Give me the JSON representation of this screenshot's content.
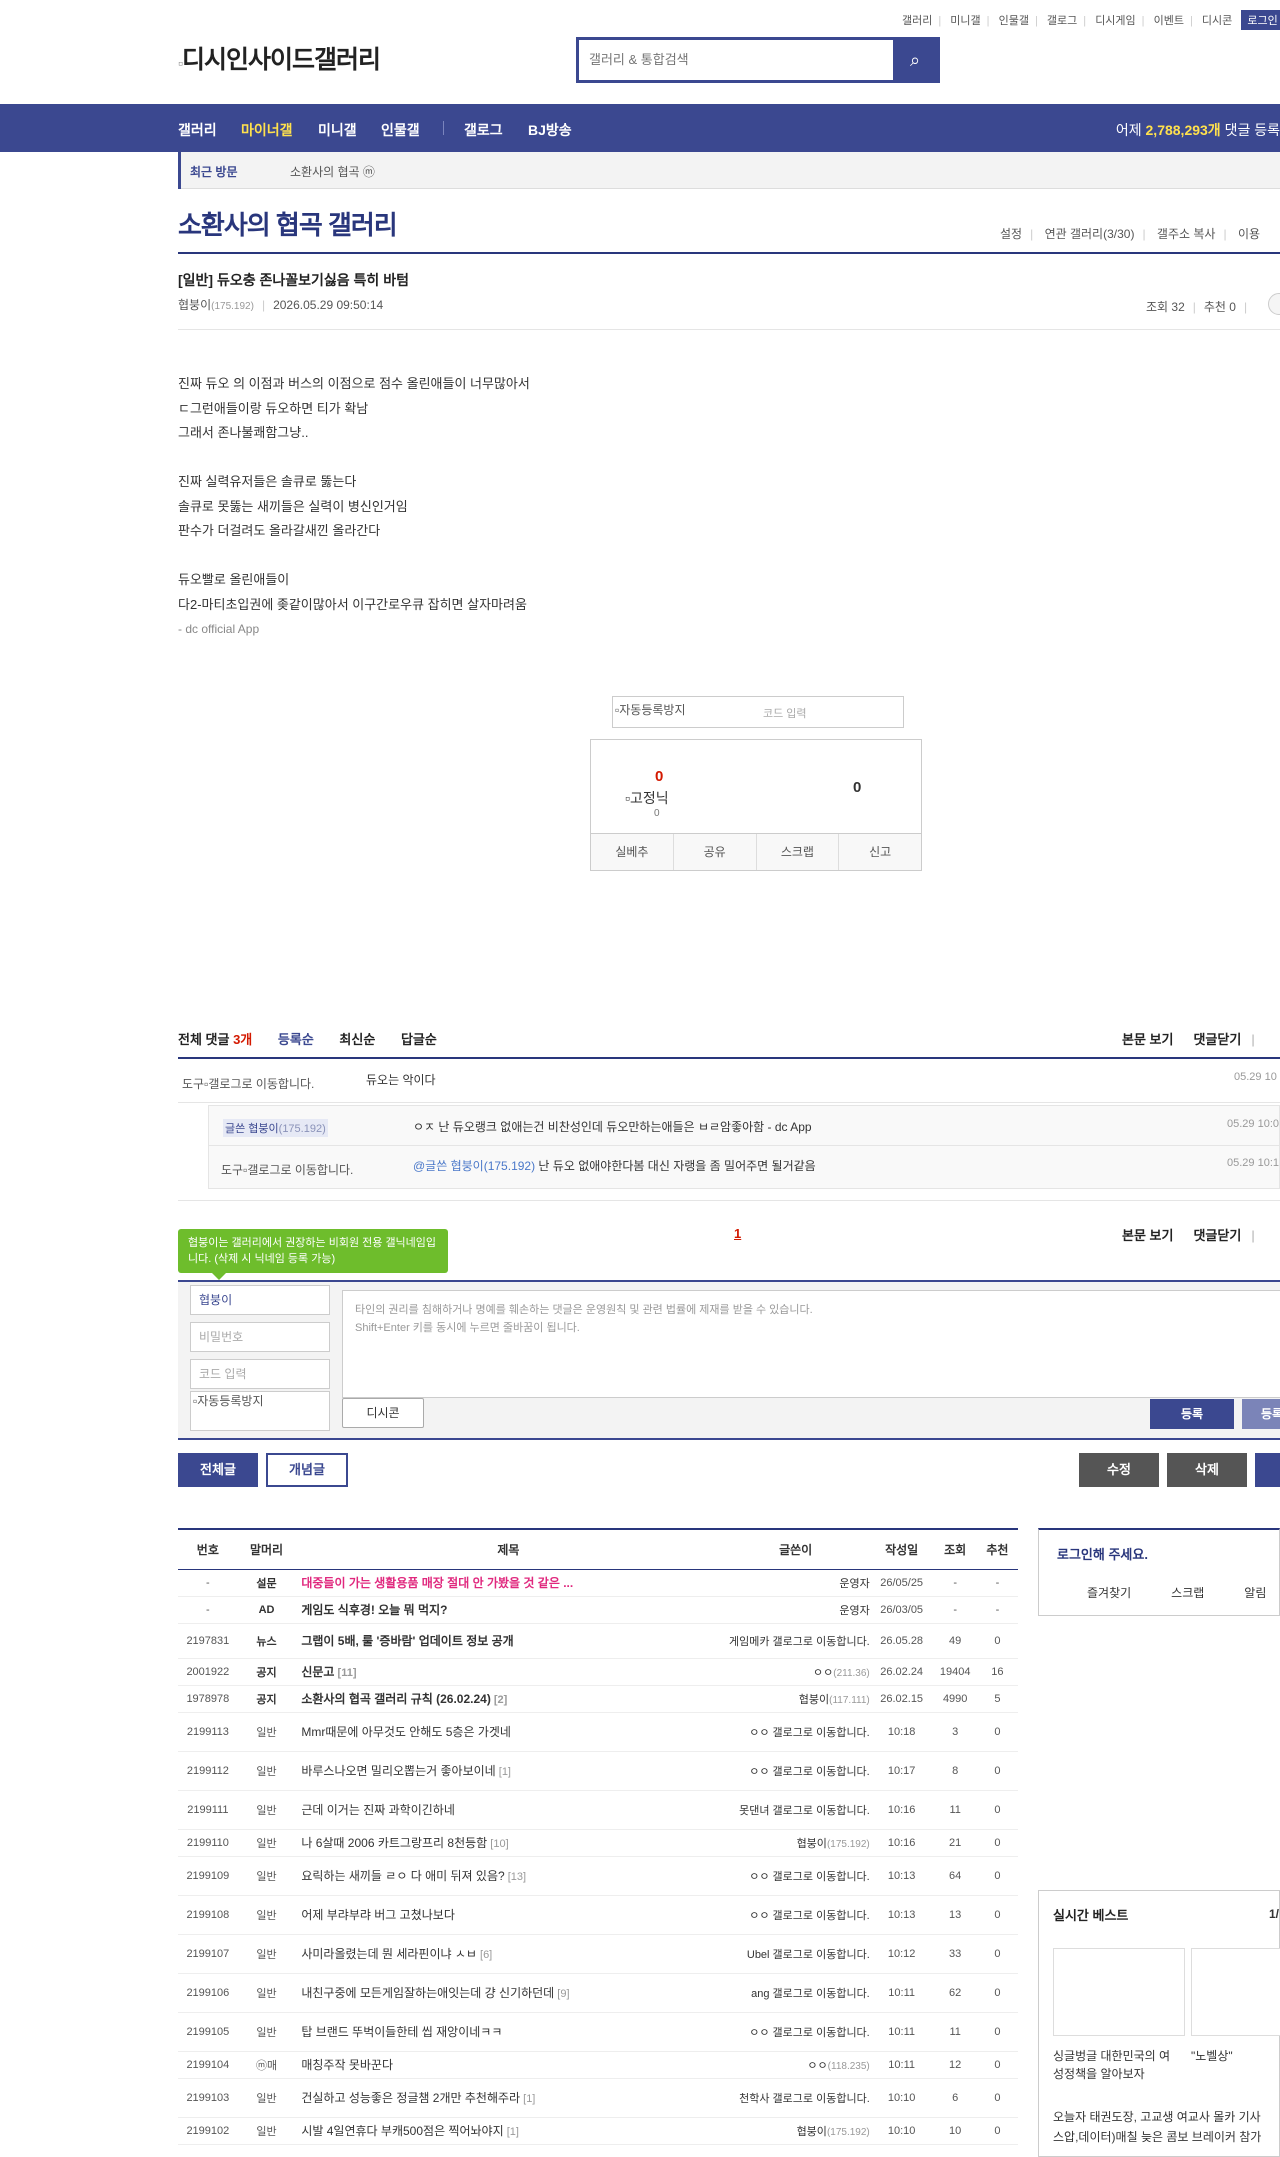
{
  "topmenu": [
    "갤러리",
    "미니갤",
    "인물갤",
    "갤로그",
    "디시게임",
    "이벤트",
    "디시콘"
  ],
  "login_label": "로그인",
  "logo_text": "디시인사이드갤러리",
  "search": {
    "placeholder": "갤러리 & 통합검색"
  },
  "nav": {
    "items": [
      "갤러리",
      "마이너갤",
      "미니갤",
      "인물갤",
      "갤로그",
      "BJ방송"
    ],
    "right_prefix": "어제 ",
    "right_count": "2,788,293개",
    "right_suffix": " 댓글 등록"
  },
  "recent": {
    "label": "최근 방문",
    "item": "소환사의 협곡 ⓜ"
  },
  "gallery": {
    "title": "소환사의 협곡 갤러리",
    "options": [
      "설정",
      "연관 갤러리(3/30)",
      "갤주소 복사",
      "이용"
    ]
  },
  "post": {
    "title": "[일반] 듀오충 존나꼴보기싫음 특히 바텀",
    "author": "협붕이",
    "ip": "(175.192)",
    "datetime": "2026.05.29 09:50:14",
    "views": "조회 32",
    "recommend": "추천 0",
    "lines": [
      "진짜 듀오 의 이점과 버스의 이점으로 점수 올린애들이 너무많아서",
      "ㄷ그런애들이랑 듀오하면 티가 확남",
      "그래서 존나불쾌함그냥..",
      "",
      "진짜 실력유저들은 솔큐로 뚫는다",
      "솔큐로 못뚫는 새끼들은 실력이 병신인거임",
      "판수가 더걸려도 올라갈새낀 올라간다",
      "",
      "듀오빨로 올린애들이",
      "다2-마티초입권에 좆같이많아서 이구간로우큐 잡히면 살자마려움"
    ],
    "footer": "- dc official App"
  },
  "captcha": {
    "img_alt": "자동등록방지",
    "placeholder": "코드 입력"
  },
  "vote": {
    "up": "0",
    "fix_alt": "고정닉",
    "fix_count": "0",
    "down": "0",
    "buttons": [
      "실베추",
      "공유",
      "스크랩",
      "신고"
    ]
  },
  "comments": {
    "label": "전체 댓글",
    "count": "3개",
    "tabs": [
      "등록순",
      "최신순",
      "답글순"
    ],
    "right": [
      "본문 보기",
      "댓글닫기"
    ],
    "items": [
      {
        "nick_prefix": "도구",
        "img_alt": "갤로그로 이동합니다.",
        "text": "듀오는 악이다",
        "date": "05.29 10"
      },
      {
        "nick": "글쓴 협붕이",
        "ip": "(175.192)",
        "text": "ㅇㅈ 난 듀오랭크 없애는건 비찬성인데 듀오만하는애들은 ㅂㄹ암좋아함 - dc App",
        "date": "05.29 10:0"
      },
      {
        "nick_prefix": "도구",
        "img_alt": "갤로그로 이동합니다.",
        "mention": "@글쓴 협붕이(175.192)",
        "text": " 난 듀오 없애야한다봄 대신 자랭을 좀 밀어주면 될거같음",
        "date": "05.29 10:1"
      }
    ],
    "page": "1"
  },
  "write": {
    "tooltip": "협붕이는 갤러리에서 권장하는 비회원 전용 갤닉네임입니다. (삭제 시 닉네임 등록 가능)",
    "nick": "협붕이",
    "pw_placeholder": "비밀번호",
    "code_placeholder": "코드 입력",
    "captcha_alt": "자동등록방지",
    "textarea": "타인의 권리를 침해하거나 명예를 훼손하는 댓글은 운영원칙 및 관련 법률에 제재를 받을 수 있습니다.",
    "textarea2": "Shift+Enter 키를 동시에 누르면 줄바꿈이 됩니다.",
    "dccon": "디시콘",
    "submit": "등록",
    "submit2": "등록"
  },
  "buttons": {
    "all": "전체글",
    "concept": "개념글",
    "edit": "수정",
    "delete": "삭제"
  },
  "list": {
    "headers": [
      "번호",
      "말머리",
      "제목",
      "글쓴이",
      "작성일",
      "조회",
      "추천"
    ],
    "rows": [
      {
        "no": "-",
        "tag": "설문",
        "title": "대중들이 가는 생활용품 매장 절대 안 가봤을 것 같은 ...",
        "writer": "운영자",
        "ip": "",
        "date": "26/05/25",
        "views": "-",
        "rec": "-",
        "type": "survey"
      },
      {
        "no": "-",
        "tag": "AD",
        "title": "게임도 식후경! 오늘 뭐 먹지?",
        "writer": "운영자",
        "ip": "",
        "date": "26/03/05",
        "views": "-",
        "rec": "-",
        "type": "notice"
      },
      {
        "no": "2197831",
        "tag": "뉴스",
        "title": "그랩이 5배, 룰 '증바람' 업데이트 정보 공개",
        "writer": "게임메카 갤로그로 이동합니다.",
        "ip": "",
        "date": "26.05.28",
        "views": "49",
        "rec": "0",
        "type": "notice"
      },
      {
        "no": "2001922",
        "tag": "공지",
        "title": "신문고",
        "rc": " [11]",
        "writer": "ㅇㅇ",
        "ip": "(211.36)",
        "date": "26.02.24",
        "views": "19404",
        "rec": "16",
        "type": "notice"
      },
      {
        "no": "1978978",
        "tag": "공지",
        "title": "소환사의 협곡 갤러리 규칙 (26.02.24)",
        "rc": " [2]",
        "writer": "협붕이",
        "ip": "(117.111)",
        "date": "26.02.15",
        "views": "4990",
        "rec": "5",
        "type": "notice"
      },
      {
        "no": "2199113",
        "tag": "일반",
        "title": "Mmr때문에 아무것도 안해도 5층은 가겟네",
        "writer": "ㅇㅇ 갤로그로 이동합니다.",
        "ip": "",
        "date": "10:18",
        "views": "3",
        "rec": "0",
        "type": ""
      },
      {
        "no": "2199112",
        "tag": "일반",
        "title": "바루스나오면 밀리오뽑는거 좋아보이네",
        "rc": " [1]",
        "writer": "ㅇㅇ 갤로그로 이동합니다.",
        "ip": "",
        "date": "10:17",
        "views": "8",
        "rec": "0",
        "type": ""
      },
      {
        "no": "2199111",
        "tag": "일반",
        "title": "근데 이거는 진짜 과학이긴하네",
        "writer": "못댄녀 갤로그로 이동합니다.",
        "ip": "",
        "date": "10:16",
        "views": "11",
        "rec": "0",
        "type": ""
      },
      {
        "no": "2199110",
        "tag": "일반",
        "title": "나 6살때 2006 카트그랑프리 8천등함",
        "rc": " [10]",
        "writer": "협붕이",
        "ip": "(175.192)",
        "date": "10:16",
        "views": "21",
        "rec": "0",
        "type": ""
      },
      {
        "no": "2199109",
        "tag": "일반",
        "title": "요릭하는 새끼들 ㄹㅇ 다 애미 뒤져 있음?",
        "rc": " [13]",
        "writer": "ㅇㅇ 갤로그로 이동합니다.",
        "ip": "",
        "date": "10:13",
        "views": "64",
        "rec": "0",
        "type": ""
      },
      {
        "no": "2199108",
        "tag": "일반",
        "title": "어제 부랴부랴 버그 고쳤나보다",
        "writer": "ㅇㅇ 갤로그로 이동합니다.",
        "ip": "",
        "date": "10:13",
        "views": "13",
        "rec": "0",
        "type": ""
      },
      {
        "no": "2199107",
        "tag": "일반",
        "title": "사미라올렸는데 뭔 세라핀이냐 ㅅㅂ",
        "rc": " [6]",
        "writer": "Ubel 갤로그로 이동합니다.",
        "ip": "",
        "date": "10:12",
        "views": "33",
        "rec": "0",
        "type": ""
      },
      {
        "no": "2199106",
        "tag": "일반",
        "title": "내친구중에 모든게임잘하는애잇는데 걍 신기하던데",
        "rc": " [9]",
        "writer": "ang 갤로그로 이동합니다.",
        "ip": "",
        "date": "10:11",
        "views": "62",
        "rec": "0",
        "type": ""
      },
      {
        "no": "2199105",
        "tag": "일반",
        "title": "탑 브랜드 뚜벅이들한테 씹 재앙이네ㅋㅋ",
        "writer": "ㅇㅇ 갤로그로 이동합니다.",
        "ip": "",
        "date": "10:11",
        "views": "11",
        "rec": "0",
        "type": ""
      },
      {
        "no": "2199104",
        "tag": "ⓜ매",
        "title": "매칭주작 못바꾼다",
        "writer": "ㅇㅇ",
        "ip": "(118.235)",
        "date": "10:11",
        "views": "12",
        "rec": "0",
        "type": ""
      },
      {
        "no": "2199103",
        "tag": "일반",
        "title": "건실하고 성능좋은 정글챔 2개만 추천해주라",
        "rc": " [1]",
        "writer": "천학사 갤로그로 이동합니다.",
        "ip": "",
        "date": "10:10",
        "views": "6",
        "rec": "0",
        "type": ""
      },
      {
        "no": "2199102",
        "tag": "일반",
        "title": "시발 4일연휴다 부캐500점은 찍어놔야지",
        "rc": " [1]",
        "writer": "협붕이",
        "ip": "(175.192)",
        "date": "10:10",
        "views": "10",
        "rec": "0",
        "type": ""
      }
    ]
  },
  "side": {
    "login_prompt": "로그인해 주세요.",
    "links": [
      "즐겨찾기",
      "스크랩",
      "알림"
    ],
    "best_title": "실시간 베스트",
    "best_page": "1/",
    "cap1a": "싱글벙글 대한민국의 여",
    "cap1b": "성정책을 알아보자",
    "cap2": "\"노벨상\"",
    "news1": "오늘자 태권도장, 고교생 여교사 몰카 기사",
    "news2": "스압,데이터)매칠 늦은 콤보 브레이커 참가"
  },
  "colors": {
    "brand": "#3b4890",
    "title": "#29367c",
    "accent_red": "#d31900",
    "survey": "#e0287e",
    "tooltip": "#6ebd2c"
  }
}
